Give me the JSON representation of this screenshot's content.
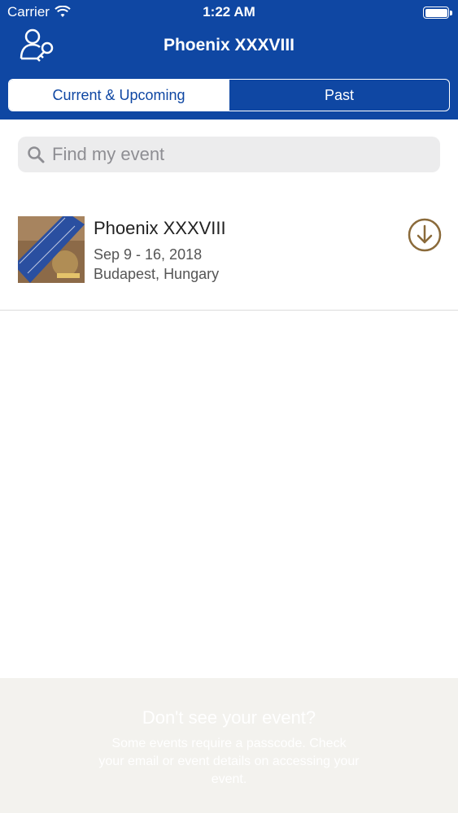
{
  "status": {
    "carrier": "Carrier",
    "time": "1:22 AM"
  },
  "nav": {
    "title": "Phoenix XXXVIII",
    "login_icon": "user-key-icon"
  },
  "tabs": [
    {
      "label": "Current & Upcoming",
      "selected": true
    },
    {
      "label": "Past",
      "selected": false
    }
  ],
  "search": {
    "placeholder": "Find my event",
    "value": ""
  },
  "events": [
    {
      "title": "Phoenix XXXVIII",
      "dates": "Sep 9 - 16, 2018",
      "location": "Budapest, Hungary",
      "action_icon": "download-icon"
    }
  ],
  "footer": {
    "title": "Don't see your event?",
    "body": "Some events require a passcode. Check your email or event details on accessing your event."
  },
  "colors": {
    "brand": "#0f47a3",
    "accent": "#8a6a3a",
    "background": "#ffffff"
  }
}
